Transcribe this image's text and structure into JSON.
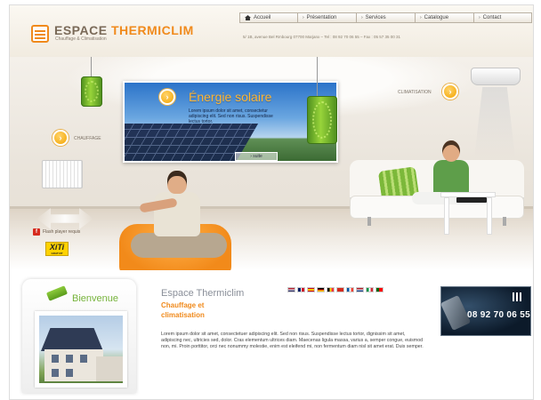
{
  "header": {
    "logo_prefix": "ESPACE",
    "logo_accent": "THERMICLIM",
    "tagline": "Chauffage & Climatisation",
    "address": "5/ 1B, avenue Bel Rmbourg 07700 Marjanx – Tel : 08 92 70 06 55 – Fax : 05 57 35 00 31"
  },
  "nav": [
    {
      "label": "Accueil",
      "icon": "house-icon"
    },
    {
      "label": "Présentation",
      "icon": "arrow-icon"
    },
    {
      "label": "Services",
      "icon": "arrow-icon"
    },
    {
      "label": "Catalogue",
      "icon": "arrow-icon"
    },
    {
      "label": "Contact",
      "icon": "arrow-icon"
    }
  ],
  "hero": {
    "chauffage_label": "CHAUFFAGE",
    "climatisation_label": "CLIMATISATION",
    "solar_title": "Énergie solaire",
    "solar_text": "Lorem ipsum dolor sit amet, consectetur adipiscing elit. Sed non risus. Suspendisse lectus tortor.",
    "solar_more": "› suite",
    "flash_required": "Flash player requis",
    "xiti_logo": "XiTi",
    "xiti_sub": "GRATUIT"
  },
  "welcome": {
    "title": "Bienvenue"
  },
  "content": {
    "title": "Espace Thermiclim",
    "subtitle": "Chauffage et climatisation",
    "body": "Lorem ipsum dolor sit amet, consectetuer adipiscing elit. Sed non risus. Suspendisse lectus tortor, dignissim sit amet, adipiscing nec, ultricies sed, dolor. Cras elementum ultrices diam. Maecenas ligula massa, varius a, semper congue, euismod non, mi. Proin porttitor, orci nec nonummy molestie, enim est eleifend mi, non fermentum diam nisl sit amet erat. Duis semper.",
    "flags": [
      "#b22234",
      "#cf142b",
      "#c60b1e",
      "#dd0000",
      "#ffcc00",
      "#d52b1e",
      "#ff0000",
      "#21468b",
      "#009246",
      "#006600"
    ]
  },
  "phone": {
    "number": "08 92 70 06 55"
  },
  "colors": {
    "accent": "#f08a1c",
    "green": "#76b33b"
  }
}
